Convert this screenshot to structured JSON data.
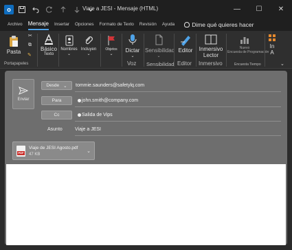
{
  "titlebar": {
    "app_icon": "outlook-icon",
    "app_letter": "o",
    "title": "Viaje a JESI - Mensaje (HTML)",
    "controls": {
      "minimize": "—",
      "maximize": "☐",
      "close": "✕"
    }
  },
  "tabs": [
    {
      "label": "Archivo"
    },
    {
      "label": "Mensaje",
      "active": true
    },
    {
      "label": "Insertar"
    },
    {
      "label": "Opciones"
    },
    {
      "label": "Formato de Texto"
    },
    {
      "label": "Revisión"
    },
    {
      "label": "Ayuda"
    }
  ],
  "tell_me": "Dime qué quieres hacer",
  "ribbon": {
    "paste": "Pasta",
    "basic_text": "Básico",
    "basic_text_sub": "Texto",
    "names": "Nombres",
    "include": "Incluyen",
    "tags": "Objetos",
    "dictate": "Dictar",
    "sensitivity": "Sensibilidad",
    "editor": "Editor",
    "immersive_reader": "Inmersivo",
    "immersive_reader_sub": "Lector",
    "scheduling": "Encuesta de Programación",
    "scheduling_new": "Nuevo",
    "group_clipboard": "Portapapeles",
    "group_voice": "Voz",
    "group_sensitivity": "Sensibilidad",
    "group_editor": "Editor",
    "group_immersive": "Inmersivo",
    "group_poll": "Encuesta Tiempo",
    "last_label": "In",
    "last_label_sub": "A"
  },
  "compose": {
    "send_label": "Enviar",
    "from_label": "Desde",
    "from_value": "tommie.saunders@safetylq.com",
    "to_label": "Para",
    "to_value": "john.smith@company.com",
    "cc_label": "Cc",
    "cc_value": "Salida de Vips",
    "subject_label": "Asunto",
    "subject_value": "Viaje a JESI"
  },
  "attachment": {
    "name": "Viaje de JESI Agosto.pdf",
    "size": "47 KB",
    "type_label": "PDF"
  },
  "colors": {
    "accent": "#4fa3e8",
    "outlook_blue": "#0f6cbd",
    "pdf_red": "#c9302c"
  }
}
